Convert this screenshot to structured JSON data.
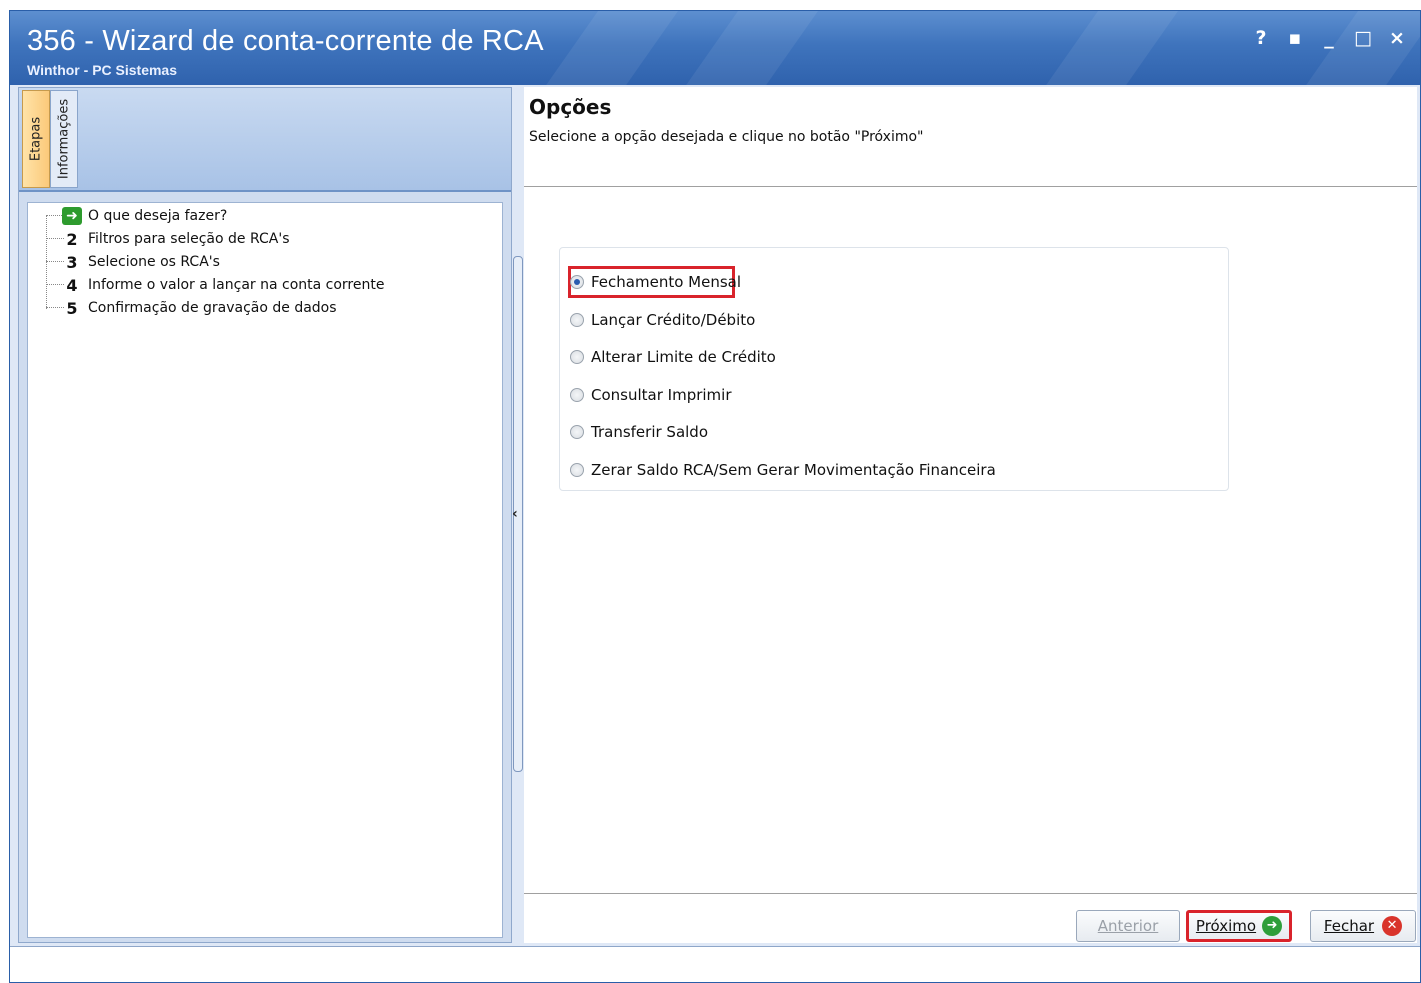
{
  "window": {
    "title": "356 - Wizard de conta-corrente de RCA",
    "subtitle": "Winthor - PC Sistemas",
    "controls": {
      "help": "?",
      "restore": "▪",
      "minimize": "_",
      "maximize": "□",
      "close": "×"
    }
  },
  "left_panel": {
    "tabs": [
      "Etapas",
      "Informações"
    ],
    "active_tab": "Etapas",
    "steps": [
      {
        "marker": "arrow-icon",
        "label": "O que deseja fazer?"
      },
      {
        "marker": "2",
        "label": "Filtros para seleção de RCA's"
      },
      {
        "marker": "3",
        "label": "Selecione os RCA's"
      },
      {
        "marker": "4",
        "label": "Informe o valor a lançar na conta corrente"
      },
      {
        "marker": "5",
        "label": "Confirmação de gravação de dados"
      }
    ]
  },
  "main": {
    "title": "Opções",
    "subtitle": "Selecione a opção desejada e clique no botão \"Próximo\"",
    "options": [
      {
        "label": "Fechamento Mensal",
        "checked": true
      },
      {
        "label": "Lançar Crédito/Débito",
        "checked": false
      },
      {
        "label": "Alterar Limite de Crédito",
        "checked": false
      },
      {
        "label": "Consultar Imprimir",
        "checked": false
      },
      {
        "label": "Transferir Saldo",
        "checked": false
      },
      {
        "label": "Zerar Saldo RCA/Sem Gerar Movimentação Financeira",
        "checked": false
      }
    ]
  },
  "buttons": {
    "previous": "Anterior",
    "next": "Próximo",
    "close": "Fechar"
  },
  "colors": {
    "titlebar": "#3f74bd",
    "highlight": "#d9232b",
    "go_icon": "#2f9e3a",
    "close_icon": "#d9342b"
  }
}
